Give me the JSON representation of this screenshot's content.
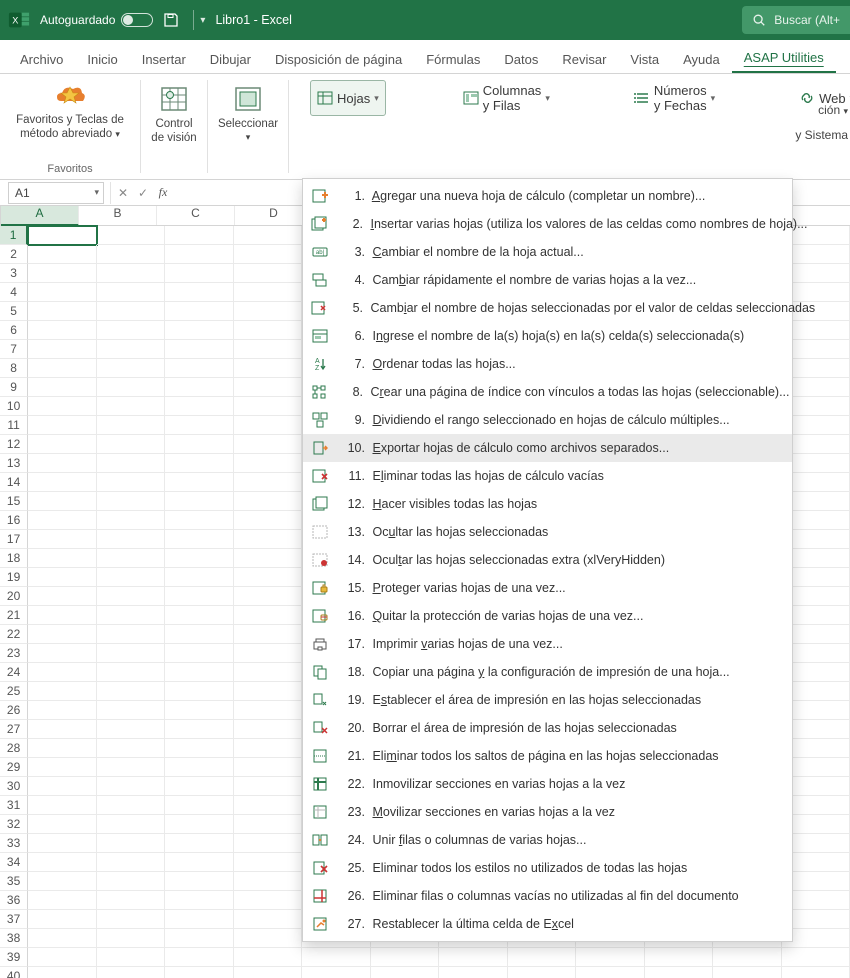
{
  "titlebar": {
    "autosave": "Autoguardado",
    "doc": "Libro1  -  Excel"
  },
  "search": {
    "placeholder": "Buscar (Alt+"
  },
  "tabs": [
    "Archivo",
    "Inicio",
    "Insertar",
    "Dibujar",
    "Disposición de página",
    "Fórmulas",
    "Datos",
    "Revisar",
    "Vista",
    "Ayuda",
    "ASAP Utilities"
  ],
  "ribbon": {
    "fav": {
      "line1": "Favoritos y Teclas de",
      "line2": "método abreviado",
      "caption": "Favoritos"
    },
    "vision": {
      "line1": "Control",
      "line2": "de visión"
    },
    "select": {
      "line1": "Seleccionar"
    },
    "hojas": "Hojas",
    "colfilas": "Columnas y Filas",
    "numfechas": "Números y Fechas",
    "web": "Web",
    "trunc1": "ción",
    "trunc2": "y Sistema"
  },
  "cellref": "A1",
  "columns": [
    "A",
    "B",
    "C",
    "D"
  ],
  "menu_highlight_index": 9,
  "menu": [
    {
      "n": "1",
      "pre": "",
      "u": "A",
      "post": "gregar una nueva hoja de cálculo (completar un nombre)..."
    },
    {
      "n": "2",
      "pre": "",
      "u": "I",
      "post": "nsertar varias hojas (utiliza los valores de las celdas como nombres de hoja)..."
    },
    {
      "n": "3",
      "pre": "",
      "u": "C",
      "post": "ambiar el nombre de la hoja actual..."
    },
    {
      "n": "4",
      "pre": "Cam",
      "u": "b",
      "post": "iar rápidamente el nombre de varias hojas a la vez..."
    },
    {
      "n": "5",
      "pre": "Camb",
      "u": "i",
      "post": "ar el nombre de hojas seleccionadas por el valor de celdas seleccionadas"
    },
    {
      "n": "6",
      "pre": "I",
      "u": "n",
      "post": "grese el nombre de la(s) hoja(s) en la(s) celda(s) seleccionada(s)"
    },
    {
      "n": "7",
      "pre": "",
      "u": "O",
      "post": "rdenar todas las hojas..."
    },
    {
      "n": "8",
      "pre": "C",
      "u": "r",
      "post": "ear una página de índice con vínculos a todas las hojas (seleccionable)..."
    },
    {
      "n": "9",
      "pre": "",
      "u": "D",
      "post": "ividiendo el rango seleccionado en hojas de cálculo múltiples..."
    },
    {
      "n": "10",
      "pre": "",
      "u": "E",
      "post": "xportar hojas de cálculo como archivos separados..."
    },
    {
      "n": "11",
      "pre": "E",
      "u": "l",
      "post": "iminar todas las hojas de cálculo vacías"
    },
    {
      "n": "12",
      "pre": "",
      "u": "H",
      "post": "acer visibles todas las hojas"
    },
    {
      "n": "13",
      "pre": "Oc",
      "u": "u",
      "post": "ltar las hojas seleccionadas"
    },
    {
      "n": "14",
      "pre": "Ocul",
      "u": "t",
      "post": "ar las hojas seleccionadas extra (xlVeryHidden)"
    },
    {
      "n": "15",
      "pre": "",
      "u": "P",
      "post": "roteger varias hojas de una vez..."
    },
    {
      "n": "16",
      "pre": "",
      "u": "Q",
      "post": "uitar la protección de varias hojas de una vez..."
    },
    {
      "n": "17",
      "pre": "Imprimir ",
      "u": "v",
      "post": "arias hojas de una vez..."
    },
    {
      "n": "18",
      "pre": "Copiar una página ",
      "u": "y",
      "post": " la configuración de impresión de una hoja..."
    },
    {
      "n": "19",
      "pre": "E",
      "u": "s",
      "post": "tablecer el área de impresión en las hojas seleccionadas"
    },
    {
      "n": "20",
      "pre": "Borrar el área de impresión de las hojas seleccionadas",
      "u": "",
      "post": ""
    },
    {
      "n": "21",
      "pre": "Eli",
      "u": "m",
      "post": "inar todos los saltos de página en las hojas seleccionadas"
    },
    {
      "n": "22",
      "pre": "Inmovilizar secciones en varias hojas a la vez",
      "u": "",
      "post": ""
    },
    {
      "n": "23",
      "pre": "",
      "u": "M",
      "post": "ovilizar secciones en varias hojas a la vez"
    },
    {
      "n": "24",
      "pre": "Unir ",
      "u": "f",
      "post": "ilas o columnas de varias hojas..."
    },
    {
      "n": "25",
      "pre": "Eliminar todos los estilos no utilizados de todas las hojas",
      "u": "",
      "post": ""
    },
    {
      "n": "26",
      "pre": "Eliminar filas o columnas vacías no utilizadas al fin del documento",
      "u": "",
      "post": ""
    },
    {
      "n": "27",
      "pre": "Restablecer la última celda de E",
      "u": "x",
      "post": "cel"
    }
  ]
}
